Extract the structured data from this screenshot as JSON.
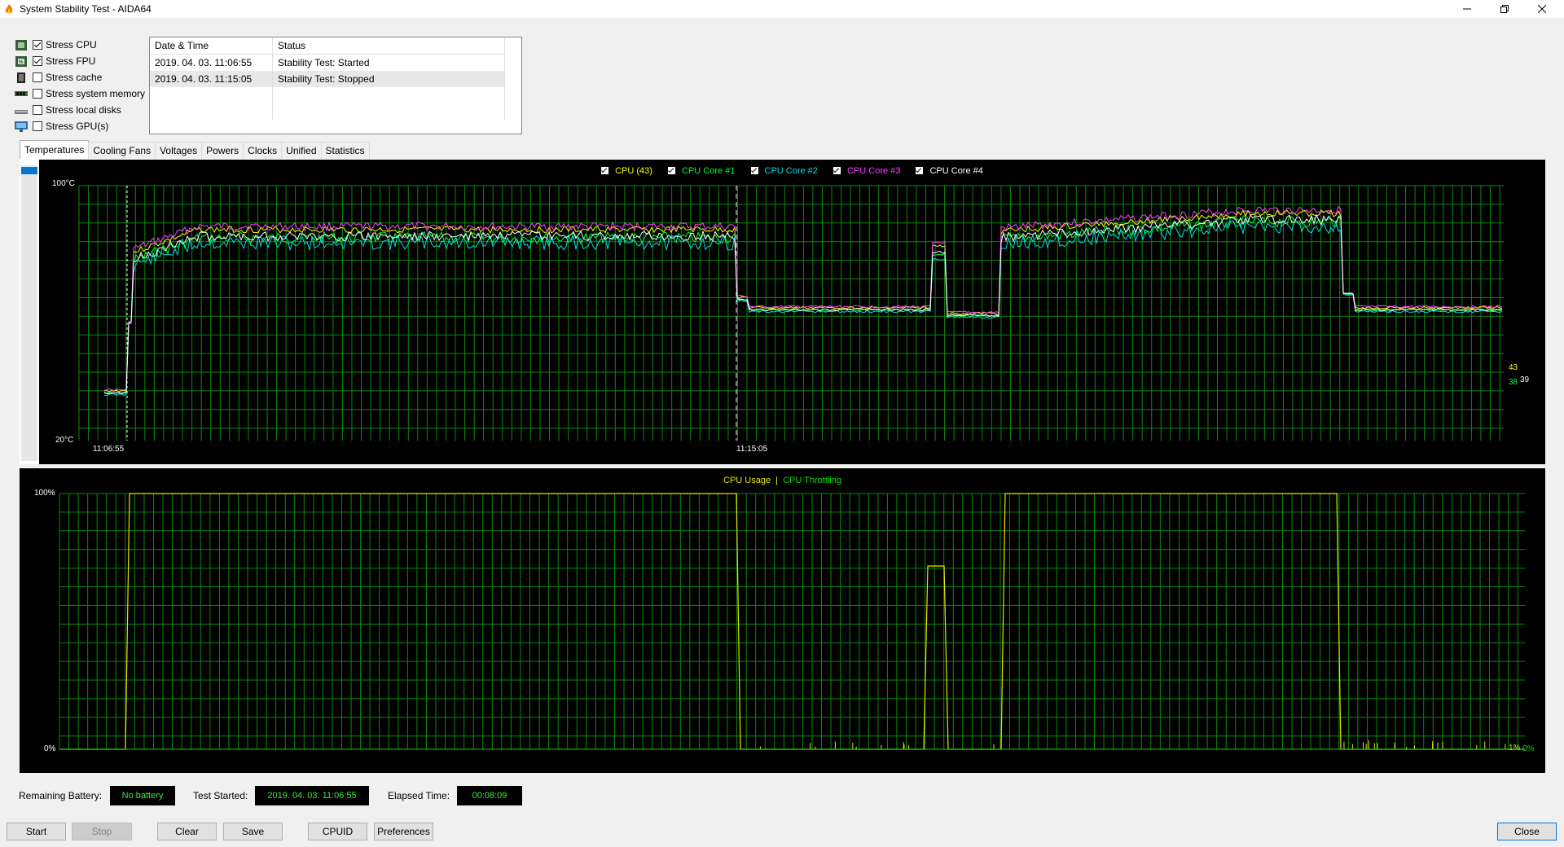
{
  "window": {
    "title": "System Stability Test - AIDA64"
  },
  "stress_options": [
    {
      "label": "Stress CPU",
      "checked": true,
      "icon": "cpu-chip-icon"
    },
    {
      "label": "Stress FPU",
      "checked": true,
      "icon": "fpu-chip-icon"
    },
    {
      "label": "Stress cache",
      "checked": false,
      "icon": "cache-chip-icon"
    },
    {
      "label": "Stress system memory",
      "checked": false,
      "icon": "memory-module-icon"
    },
    {
      "label": "Stress local disks",
      "checked": false,
      "icon": "disk-drive-icon"
    },
    {
      "label": "Stress GPU(s)",
      "checked": false,
      "icon": "monitor-icon"
    }
  ],
  "log": {
    "columns": [
      "Date & Time",
      "Status"
    ],
    "rows": [
      [
        "2019. 04. 03. 11:06:55",
        "Stability Test: Started"
      ],
      [
        "2019. 04. 03. 11:15:05",
        "Stability Test: Stopped"
      ]
    ]
  },
  "tabs": [
    "Temperatures",
    "Cooling Fans",
    "Voltages",
    "Powers",
    "Clocks",
    "Unified",
    "Statistics"
  ],
  "temp_graph": {
    "legend": [
      {
        "label": "CPU (43)",
        "color": "#ffff00"
      },
      {
        "label": "CPU Core #1",
        "color": "#00ff40"
      },
      {
        "label": "CPU Core #2",
        "color": "#00e0e0"
      },
      {
        "label": "CPU Core #3",
        "color": "#ff40ff"
      },
      {
        "label": "CPU Core #4",
        "color": "#ffffff"
      }
    ],
    "y_top": "100°C",
    "y_bottom": "20°C",
    "marker_start": "11:06:55",
    "marker_stop": "11:15:05",
    "end_values": {
      "a": "43",
      "b": "39",
      "c": "38"
    }
  },
  "usage_graph": {
    "legend_usage": "CPU Usage",
    "legend_sep": "|",
    "legend_throttle": "CPU Throttling",
    "y_top": "100%",
    "y_bottom": "0%",
    "end_usage": "1%",
    "end_throttle": "0%"
  },
  "status": {
    "battery_label": "Remaining Battery:",
    "battery_value": "No battery",
    "started_label": "Test Started:",
    "started_value": "2019. 04. 03. 11:06:55",
    "elapsed_label": "Elapsed Time:",
    "elapsed_value": "00:08:09"
  },
  "buttons": {
    "start": "Start",
    "stop": "Stop",
    "clear": "Clear",
    "save": "Save",
    "cpuid": "CPUID",
    "preferences": "Preferences",
    "close": "Close"
  },
  "colors": {
    "grid": "#0a8a0a",
    "usage": "#e6e600",
    "throttle": "#00e000"
  }
}
